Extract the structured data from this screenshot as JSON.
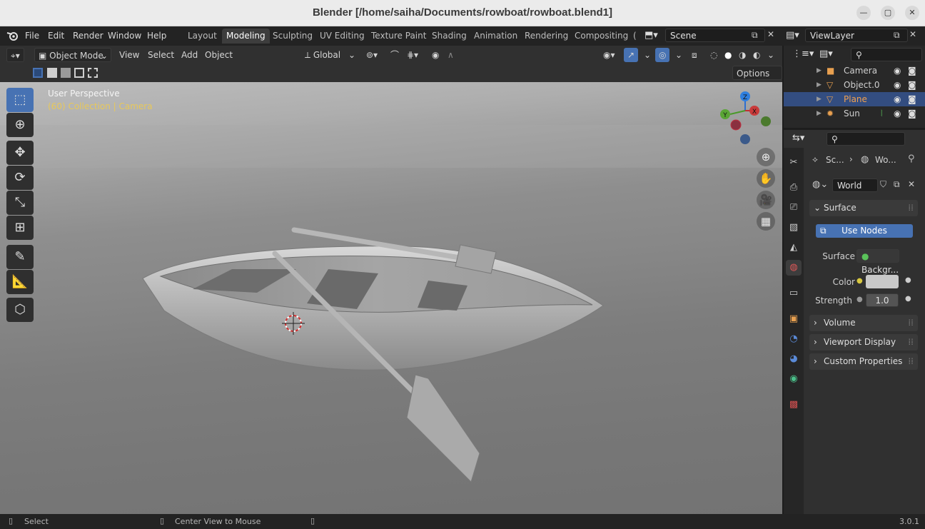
{
  "window": {
    "title": "Blender [/home/saiha/Documents/rowboat/rowboat.blend1]",
    "minimize": "—",
    "maximize": "▢",
    "close": "✕"
  },
  "menu": {
    "file": "File",
    "edit": "Edit",
    "render": "Render",
    "window": "Window",
    "help": "Help"
  },
  "workspaces": [
    "Layout",
    "Modeling",
    "Sculpting",
    "UV Editing",
    "Texture Paint",
    "Shading",
    "Animation",
    "Rendering",
    "Compositing",
    "("
  ],
  "active_workspace": "Modeling",
  "scene": {
    "label": "Scene"
  },
  "view_layer": {
    "label": "ViewLayer"
  },
  "viewport_header": {
    "mode": "Object Mode",
    "view": "View",
    "select": "Select",
    "add": "Add",
    "object": "Object",
    "transform_orientation": "Global",
    "options": "Options"
  },
  "viewport": {
    "perspective": "User Perspective",
    "collection": "(60) Collection | Camera",
    "gizmo": {
      "x": "X",
      "y": "Y",
      "z": "Z"
    }
  },
  "outliner": {
    "items": [
      {
        "name": "Camera",
        "icon": "camera-icon",
        "selected": false
      },
      {
        "name": "Object.0",
        "icon": "mesh-icon",
        "selected": false
      },
      {
        "name": "Plane",
        "icon": "mesh-icon",
        "selected": true
      },
      {
        "name": "Sun",
        "icon": "light-icon",
        "selected": false
      }
    ]
  },
  "properties": {
    "breadcrumb_scene": "Sc...",
    "breadcrumb_world": "Wo...",
    "world_name": "World",
    "surface_panel": "Surface",
    "use_nodes": "Use Nodes",
    "surface_label": "Surface",
    "surface_value": "Backgr...",
    "color_label": "Color",
    "color_value": "#c8c8c8",
    "strength_label": "Strength",
    "strength_value": "1.0",
    "volume_panel": "Volume",
    "viewport_display_panel": "Viewport Display",
    "custom_properties_panel": "Custom Properties"
  },
  "statusbar": {
    "select": "Select",
    "center_view": "Center View to Mouse",
    "version": "3.0.1"
  },
  "colors": {
    "accent": "#4772b3",
    "selected_row": "#334d80",
    "plane_text": "#f0a050",
    "collection_text": "#e8c85a"
  }
}
